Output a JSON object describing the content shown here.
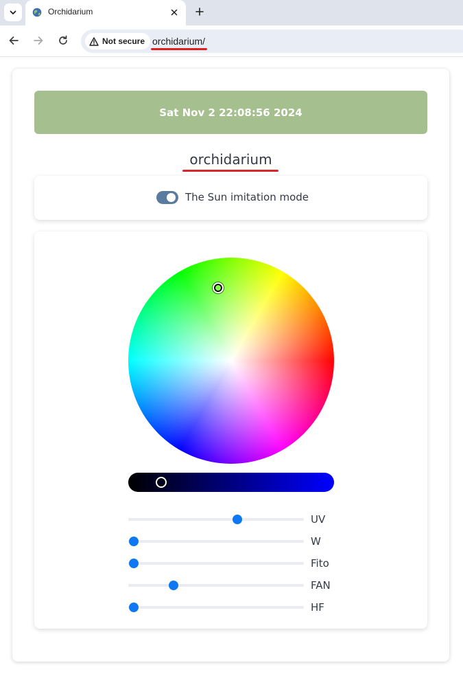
{
  "browser": {
    "tab_title": "Orchidarium",
    "security_label": "Not secure",
    "url": "orchidarium/"
  },
  "page": {
    "datetime": "Sat Nov 2 22:08:56 2024",
    "title": "orchidarium",
    "mode_label": "The Sun imitation mode",
    "mode_enabled": true
  },
  "color_picker": {
    "selected_color": "#5500ff",
    "brightness_fraction": 0.16
  },
  "sliders": [
    {
      "label": "UV",
      "value": 0.63
    },
    {
      "label": "W",
      "value": 0.0
    },
    {
      "label": "Fito",
      "value": 0.0
    },
    {
      "label": "FAN",
      "value": 0.24
    },
    {
      "label": "HF",
      "value": 0.0
    }
  ],
  "colors": {
    "datetime_bg": "#a5bf8e",
    "toggle_on": "#5a7a9e",
    "slider_thumb": "#0d78f2"
  },
  "icons": {
    "tab_menu": "chevron-down-icon",
    "favicon": "globe-icon",
    "tab_close": "close-icon",
    "new_tab": "plus-icon",
    "back": "arrow-left-icon",
    "forward": "arrow-right-icon",
    "reload": "reload-icon",
    "security": "warning-icon"
  }
}
